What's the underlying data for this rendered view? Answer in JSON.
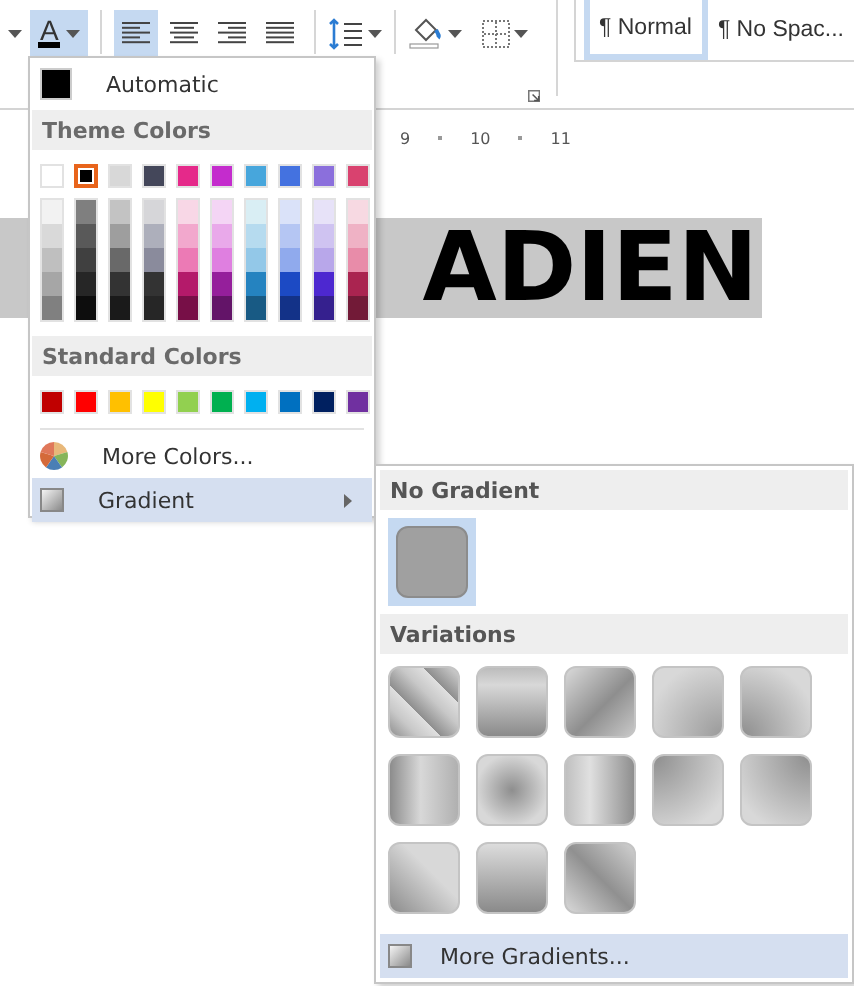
{
  "toolbar": {
    "font_color": {
      "glyph": "A",
      "selected": true
    },
    "align_buttons": [
      {
        "selected": true
      },
      {
        "selected": false
      },
      {
        "selected": false
      },
      {
        "selected": false
      }
    ]
  },
  "styles": [
    {
      "label": "¶ Normal",
      "selected": true
    },
    {
      "label": "¶ No Spac...",
      "selected": false
    }
  ],
  "ruler": [
    "9",
    "10",
    "11"
  ],
  "document": {
    "text": "ADIEN"
  },
  "color_menu": {
    "automatic": {
      "label": "Automatic",
      "color": "#000000"
    },
    "theme_header": "Theme Colors",
    "theme_colors": [
      {
        "color": "#ffffff",
        "selected": false,
        "shades": [
          {
            "color": "#f2f2f2"
          },
          {
            "color": "#d9d9d9"
          },
          {
            "color": "#bfbfbf"
          },
          {
            "color": "#a6a6a6"
          },
          {
            "color": "#808080"
          }
        ]
      },
      {
        "color": "#000000",
        "selected": true,
        "shades": [
          {
            "color": "#7f7f7f"
          },
          {
            "color": "#595959"
          },
          {
            "color": "#404040"
          },
          {
            "color": "#262626"
          },
          {
            "color": "#0d0d0d"
          }
        ]
      },
      {
        "color": "#d8d8d8",
        "selected": false,
        "shades": [
          {
            "color": "#c3c3c3"
          },
          {
            "color": "#9e9e9e"
          },
          {
            "color": "#696969"
          },
          {
            "color": "#333333"
          },
          {
            "color": "#1a1a1a"
          }
        ]
      },
      {
        "color": "#44475a",
        "selected": false,
        "shades": [
          {
            "color": "#d6d6d9"
          },
          {
            "color": "#adafbb"
          },
          {
            "color": "#8a8b9c"
          },
          {
            "color": "#333333"
          },
          {
            "color": "#262626"
          }
        ]
      },
      {
        "color": "#e5298a",
        "selected": false,
        "shades": [
          {
            "color": "#f8d7e6"
          },
          {
            "color": "#f2a8cd"
          },
          {
            "color": "#ec7ab5"
          },
          {
            "color": "#b41a6a"
          },
          {
            "color": "#770f47"
          }
        ]
      },
      {
        "color": "#c42ccd",
        "selected": false,
        "shades": [
          {
            "color": "#f4d5f5"
          },
          {
            "color": "#e9a9ea"
          },
          {
            "color": "#df7fe0"
          },
          {
            "color": "#951f9b"
          },
          {
            "color": "#631468"
          }
        ]
      },
      {
        "color": "#47a6dc",
        "selected": false,
        "shades": [
          {
            "color": "#d9eef4"
          },
          {
            "color": "#b6dbef"
          },
          {
            "color": "#93c8e8"
          },
          {
            "color": "#2583c0"
          },
          {
            "color": "#185a84"
          }
        ]
      },
      {
        "color": "#4472e0",
        "selected": false,
        "shades": [
          {
            "color": "#dae2f9"
          },
          {
            "color": "#b5c6f3"
          },
          {
            "color": "#90aaed"
          },
          {
            "color": "#1c4ac4"
          },
          {
            "color": "#133288"
          }
        ]
      },
      {
        "color": "#8b6fdc",
        "selected": false,
        "shades": [
          {
            "color": "#e7e2f8"
          },
          {
            "color": "#cfc3f1"
          },
          {
            "color": "#b8a7ea"
          },
          {
            "color": "#4d28d0"
          },
          {
            "color": "#35208e"
          }
        ]
      },
      {
        "color": "#d9426f",
        "selected": false,
        "shades": [
          {
            "color": "#f7d9e2"
          },
          {
            "color": "#efb2c5"
          },
          {
            "color": "#e88ca9"
          },
          {
            "color": "#aa2450"
          },
          {
            "color": "#721a37"
          }
        ]
      }
    ],
    "standard_header": "Standard Colors",
    "standard_colors": [
      {
        "color": "#c00000"
      },
      {
        "color": "#ff0000"
      },
      {
        "color": "#ffc000"
      },
      {
        "color": "#ffff00"
      },
      {
        "color": "#92d050"
      },
      {
        "color": "#00b050"
      },
      {
        "color": "#00b0f0"
      },
      {
        "color": "#0070c0"
      },
      {
        "color": "#002060"
      },
      {
        "color": "#7030a0"
      }
    ],
    "more_colors": "More Colors...",
    "gradient": {
      "label": "Gradient",
      "selected": true
    }
  },
  "gradient_menu": {
    "no_gradient_header": "No Gradient",
    "no_gradient": {
      "selected": true
    },
    "variations_header": "Variations",
    "variations": [
      {
        "kind": "diagdown"
      },
      {
        "kind": "vertical"
      },
      {
        "kind": "diagup"
      },
      {
        "kind": "cornerbr"
      },
      {
        "kind": "cornerbl"
      },
      {
        "kind": "horizontal"
      },
      {
        "kind": "center"
      },
      {
        "kind": "horizontalrev"
      },
      {
        "kind": "cornertl"
      },
      {
        "kind": "cornertr"
      },
      {
        "kind": "diagdownrev"
      },
      {
        "kind": "verticalrev"
      },
      {
        "kind": "diaguprev"
      }
    ],
    "more_gradients": "More Gradients..."
  }
}
